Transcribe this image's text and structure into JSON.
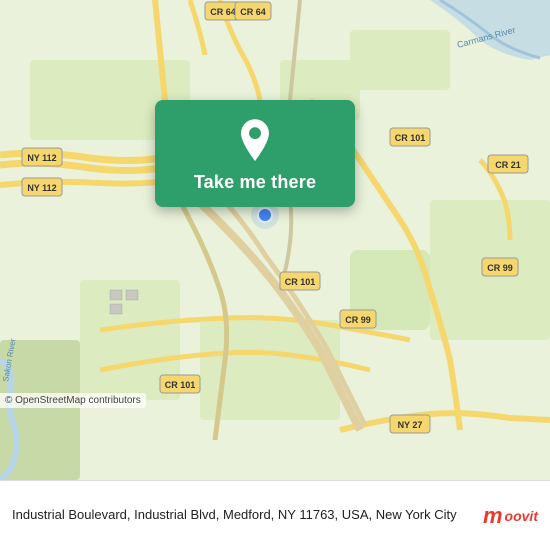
{
  "map": {
    "background_color": "#e8f0d8",
    "copyright": "© OpenStreetMap contributors"
  },
  "card": {
    "button_label": "Take me there"
  },
  "bottom_bar": {
    "address": "Industrial Boulevard, Industrial Blvd, Medford, NY\n11763, USA, New York City"
  },
  "moovit": {
    "m": "m",
    "text": "oovit"
  },
  "icons": {
    "pin": "location-pin-icon"
  }
}
